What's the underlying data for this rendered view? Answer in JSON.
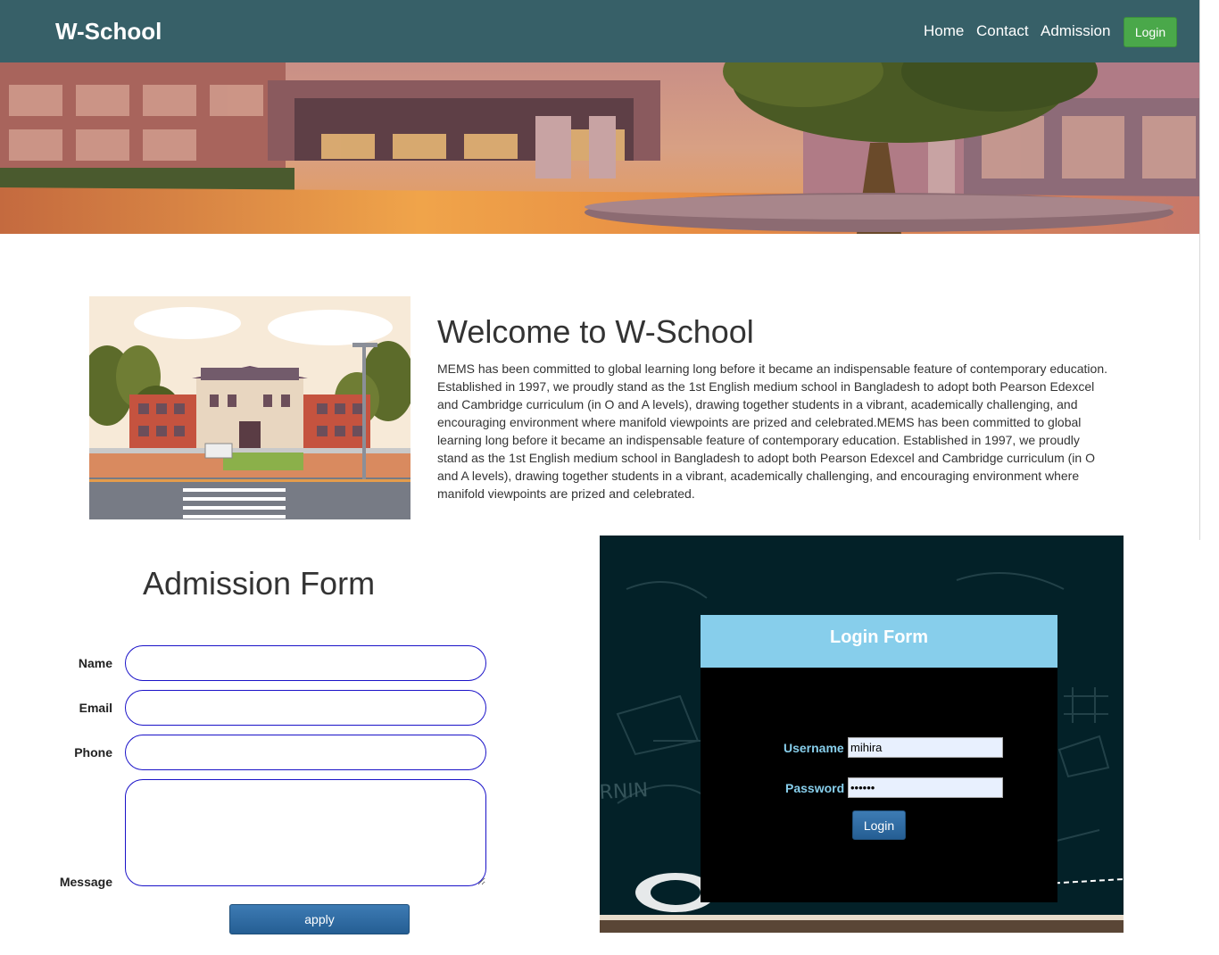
{
  "navbar": {
    "brand": "W-School",
    "links": [
      "Home",
      "Contact",
      "Admission"
    ],
    "login_label": "Login"
  },
  "welcome": {
    "title": "Welcome to W-School",
    "text": "MEMS has been committed to global learning long before it became an indispensable feature of contemporary education. Established in 1997, we proudly stand as the 1st English medium school in Bangladesh to adopt both Pearson Edexcel and Cambridge curriculum (in O and A levels), drawing together students in a vibrant, academically challenging, and encouraging environment where manifold viewpoints are prized and celebrated.MEMS has been committed to global learning long before it became an indispensable feature of contemporary education. Established in 1997, we proudly stand as the 1st English medium school in Bangladesh to adopt both Pearson Edexcel and Cambridge curriculum (in O and A levels), drawing together students in a vibrant, academically challenging, and encouraging environment where manifold viewpoints are prized and celebrated."
  },
  "admission": {
    "title": "Admission Form",
    "labels": {
      "name": "Name",
      "email": "Email",
      "phone": "Phone",
      "message": "Message"
    },
    "values": {
      "name": "",
      "email": "",
      "phone": "",
      "message": ""
    },
    "apply_label": "apply"
  },
  "login": {
    "title": "Login Form",
    "username_label": "Username",
    "password_label": "Password",
    "username_value": "mihira",
    "password_value": "••••••",
    "button_label": "Login"
  },
  "colors": {
    "navbar": "#376068",
    "login_button_green": "#4aa84a",
    "field_border": "#1a12c8",
    "login_header": "#87ceeb",
    "login_panel_bg": "#032128"
  },
  "icons": [
    "school-building-illustration",
    "hero-campus-photo",
    "chalkboard-background"
  ]
}
